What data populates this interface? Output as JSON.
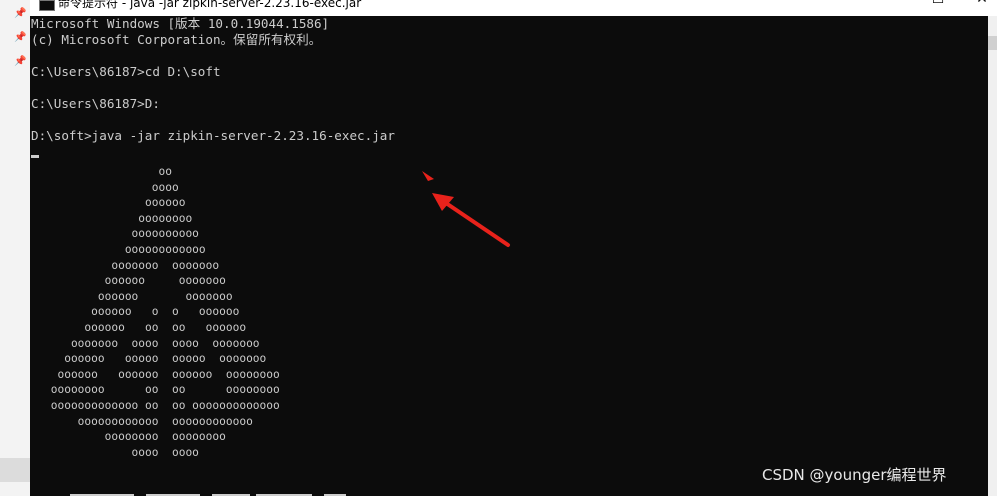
{
  "window": {
    "title": "命令提示符 - java  -jar zipkin-server-2.23.16-exec.jar",
    "minimize_glyph": "—",
    "maximize_glyph": "☐",
    "close_glyph": "✕"
  },
  "console": {
    "lines": [
      "Microsoft Windows [版本 10.0.19044.1586]",
      "(c) Microsoft Corporation。保留所有权利。",
      "",
      "C:\\Users\\86187>cd D:\\soft",
      "",
      "C:\\Users\\86187>D:",
      "",
      "D:\\soft>java -jar zipkin-server-2.23.16-exec.jar"
    ],
    "banner": [
      "                 oo",
      "                oooo",
      "               oooooo",
      "              oooooooo",
      "             oooooooooo",
      "            oooooooooooo",
      "          ooooooo  ooooooo",
      "         oooooo     ooooooo",
      "        oooooo       ooooooo",
      "       oooooo   o  o   oooooo",
      "      oooooo   oo  oo   oooooo",
      "    ooooooo  oooo  oooo  ooooooo",
      "   oooooo   ooooo  ooooo  ooooooo",
      "  oooooo   oooooo  oooooo  oooooooo",
      " oooooooo      oo  oo      oooooooo",
      " ooooooooooooo oo  oo ooooooooooooo",
      "     oooooooooooo  oooooooooooo",
      "         oooooooo  oooooooo",
      "             oooo  oooo"
    ]
  },
  "watermark": "CSDN @younger编程世界",
  "colors": {
    "console_bg": "#0c0c0c",
    "console_text": "#cccccc",
    "annotation": "#e8221b"
  }
}
